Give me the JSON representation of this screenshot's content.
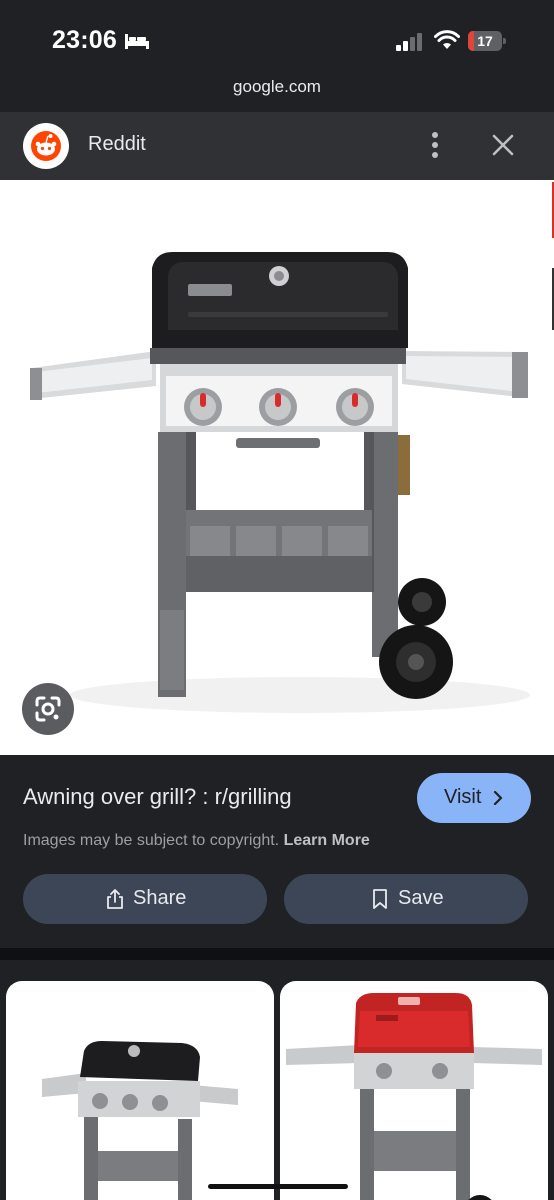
{
  "status_bar": {
    "time": "23:06",
    "battery_level": "17",
    "battery_fraction": 0.17,
    "icons": [
      "bed-icon",
      "cellular-signal-icon",
      "wifi-icon",
      "battery-icon"
    ]
  },
  "browser": {
    "url": "google.com"
  },
  "header": {
    "site_name": "Reddit",
    "icons": [
      "reddit-logo",
      "more-vert-icon",
      "close-icon"
    ]
  },
  "preview": {
    "icons": [
      "google-lens-icon"
    ]
  },
  "result": {
    "title": "Awning over grill? : r/grilling",
    "visit_label": "Visit",
    "copyright_text": "Images may be subject to copyright.",
    "learn_more_label": "Learn More",
    "share_label": "Share",
    "save_label": "Save"
  },
  "colors": {
    "accent": "#8ab4f8",
    "reddit_orange": "#ff4500",
    "button_bg": "#3c4657",
    "grill_red": "#d92b2b"
  }
}
